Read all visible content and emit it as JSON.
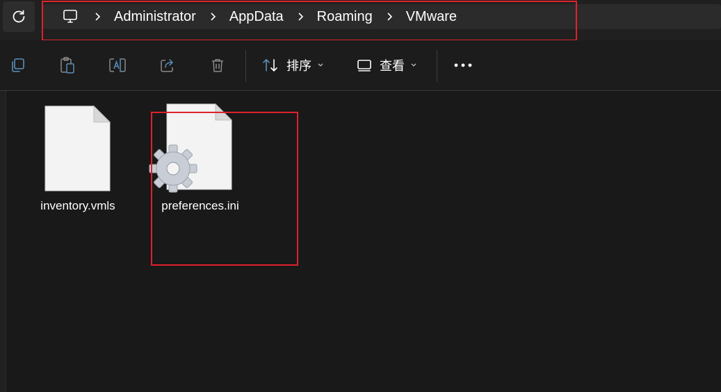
{
  "breadcrumb": {
    "root_icon": "computer-icon",
    "items": [
      "Administrator",
      "AppData",
      "Roaming",
      "VMware"
    ]
  },
  "toolbar": {
    "icons": [
      "copy-icon",
      "paste-icon",
      "rename-icon",
      "share-icon",
      "delete-icon"
    ],
    "sort_label": "排序",
    "view_label": "查看",
    "more_icon": "more-icon"
  },
  "files": [
    {
      "name": "inventory.vmls",
      "icon": "document-icon"
    },
    {
      "name": "preferences.ini",
      "icon": "settings-file-icon"
    }
  ],
  "colors": {
    "highlight": "#e0212b",
    "background": "#191919",
    "icon_blue": "#5b8fb9",
    "icon_gray": "#8a8a8a"
  }
}
